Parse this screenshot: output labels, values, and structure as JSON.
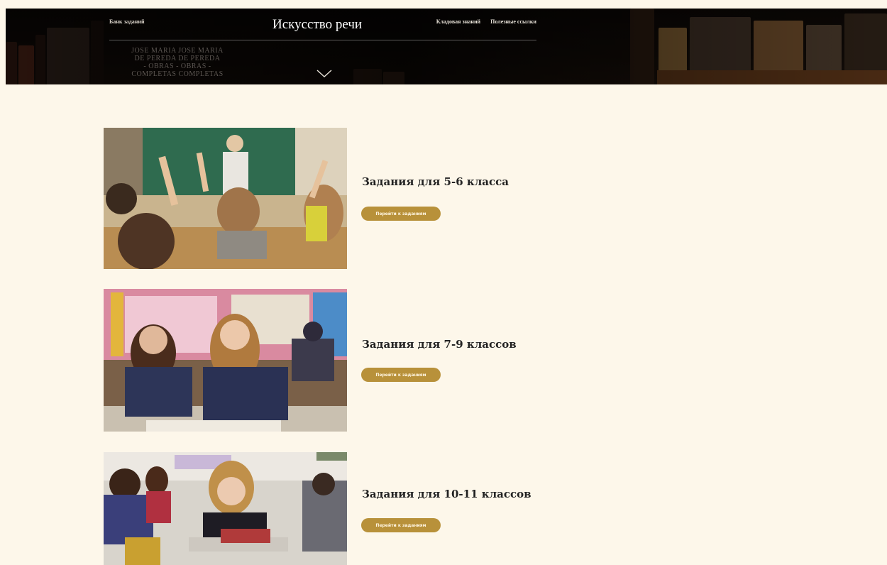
{
  "header": {
    "site_title": "Искусство речи",
    "nav_left": "Банк заданий",
    "nav_right": [
      "Кладовая знаний",
      "Полезные ссылки"
    ],
    "book_spines": "JOSE MARIA JOSE MARIA\nDE PEREDA DE PEREDA\n- OBRAS - OBRAS -\nCOMPLETAS COMPLETAS",
    "scroll_icon": "chevron-down-icon"
  },
  "cards": [
    {
      "title": "Задания для 5-6 класса",
      "button": "Перейти к заданиям"
    },
    {
      "title": "Задания для 7-9 классов",
      "button": "Перейти к заданиям"
    },
    {
      "title": "Задания для 10-11 классов",
      "button": "Перейти к заданиям"
    }
  ],
  "colors": {
    "page_background": "#fdf7ea",
    "button": "#b8913a",
    "header": "#0b0705"
  }
}
